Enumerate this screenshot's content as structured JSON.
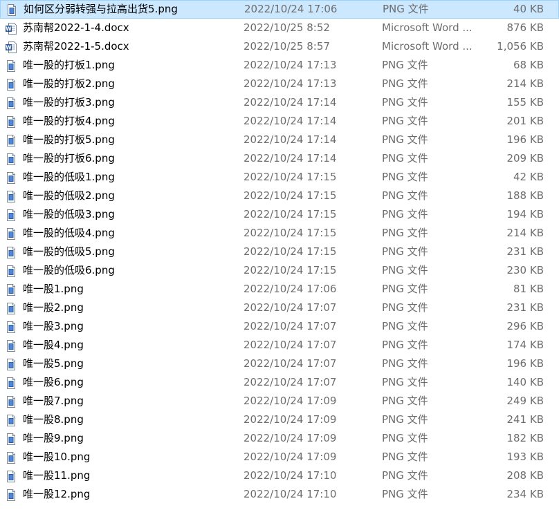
{
  "colors": {
    "selected_bg": "#cce8ff",
    "selected_border": "#99d1ff",
    "word_blue": "#2b579a",
    "png_icon_blue": "#1f5fbf"
  },
  "files": [
    {
      "name": "如何区分弱转强与拉高出货5.png",
      "date": "2022/10/24 17:06",
      "type": "PNG 文件",
      "size": "40 KB",
      "icon": "png-file-icon",
      "selected": true
    },
    {
      "name": "苏南帮2022-1-4.docx",
      "date": "2022/10/25 8:52",
      "type": "Microsoft Word ...",
      "size": "876 KB",
      "icon": "word-file-icon"
    },
    {
      "name": "苏南帮2022-1-5.docx",
      "date": "2022/10/25 8:57",
      "type": "Microsoft Word ...",
      "size": "1,056 KB",
      "icon": "word-file-icon"
    },
    {
      "name": "唯一股的打板1.png",
      "date": "2022/10/24 17:13",
      "type": "PNG 文件",
      "size": "68 KB",
      "icon": "png-file-icon"
    },
    {
      "name": "唯一股的打板2.png",
      "date": "2022/10/24 17:13",
      "type": "PNG 文件",
      "size": "214 KB",
      "icon": "png-file-icon"
    },
    {
      "name": "唯一股的打板3.png",
      "date": "2022/10/24 17:14",
      "type": "PNG 文件",
      "size": "155 KB",
      "icon": "png-file-icon"
    },
    {
      "name": "唯一股的打板4.png",
      "date": "2022/10/24 17:14",
      "type": "PNG 文件",
      "size": "201 KB",
      "icon": "png-file-icon"
    },
    {
      "name": "唯一股的打板5.png",
      "date": "2022/10/24 17:14",
      "type": "PNG 文件",
      "size": "196 KB",
      "icon": "png-file-icon"
    },
    {
      "name": "唯一股的打板6.png",
      "date": "2022/10/24 17:14",
      "type": "PNG 文件",
      "size": "209 KB",
      "icon": "png-file-icon"
    },
    {
      "name": "唯一股的低吸1.png",
      "date": "2022/10/24 17:15",
      "type": "PNG 文件",
      "size": "42 KB",
      "icon": "png-file-icon"
    },
    {
      "name": "唯一股的低吸2.png",
      "date": "2022/10/24 17:15",
      "type": "PNG 文件",
      "size": "188 KB",
      "icon": "png-file-icon"
    },
    {
      "name": "唯一股的低吸3.png",
      "date": "2022/10/24 17:15",
      "type": "PNG 文件",
      "size": "194 KB",
      "icon": "png-file-icon"
    },
    {
      "name": "唯一股的低吸4.png",
      "date": "2022/10/24 17:15",
      "type": "PNG 文件",
      "size": "214 KB",
      "icon": "png-file-icon"
    },
    {
      "name": "唯一股的低吸5.png",
      "date": "2022/10/24 17:15",
      "type": "PNG 文件",
      "size": "231 KB",
      "icon": "png-file-icon"
    },
    {
      "name": "唯一股的低吸6.png",
      "date": "2022/10/24 17:15",
      "type": "PNG 文件",
      "size": "230 KB",
      "icon": "png-file-icon"
    },
    {
      "name": "唯一股1.png",
      "date": "2022/10/24 17:06",
      "type": "PNG 文件",
      "size": "81 KB",
      "icon": "png-file-icon"
    },
    {
      "name": "唯一股2.png",
      "date": "2022/10/24 17:07",
      "type": "PNG 文件",
      "size": "231 KB",
      "icon": "png-file-icon"
    },
    {
      "name": "唯一股3.png",
      "date": "2022/10/24 17:07",
      "type": "PNG 文件",
      "size": "296 KB",
      "icon": "png-file-icon"
    },
    {
      "name": "唯一股4.png",
      "date": "2022/10/24 17:07",
      "type": "PNG 文件",
      "size": "174 KB",
      "icon": "png-file-icon"
    },
    {
      "name": "唯一股5.png",
      "date": "2022/10/24 17:07",
      "type": "PNG 文件",
      "size": "196 KB",
      "icon": "png-file-icon"
    },
    {
      "name": "唯一股6.png",
      "date": "2022/10/24 17:07",
      "type": "PNG 文件",
      "size": "140 KB",
      "icon": "png-file-icon"
    },
    {
      "name": "唯一股7.png",
      "date": "2022/10/24 17:09",
      "type": "PNG 文件",
      "size": "249 KB",
      "icon": "png-file-icon"
    },
    {
      "name": "唯一股8.png",
      "date": "2022/10/24 17:09",
      "type": "PNG 文件",
      "size": "241 KB",
      "icon": "png-file-icon"
    },
    {
      "name": "唯一股9.png",
      "date": "2022/10/24 17:09",
      "type": "PNG 文件",
      "size": "182 KB",
      "icon": "png-file-icon"
    },
    {
      "name": "唯一股10.png",
      "date": "2022/10/24 17:09",
      "type": "PNG 文件",
      "size": "193 KB",
      "icon": "png-file-icon"
    },
    {
      "name": "唯一股11.png",
      "date": "2022/10/24 17:10",
      "type": "PNG 文件",
      "size": "208 KB",
      "icon": "png-file-icon"
    },
    {
      "name": "唯一股12.png",
      "date": "2022/10/24 17:10",
      "type": "PNG 文件",
      "size": "234 KB",
      "icon": "png-file-icon"
    }
  ]
}
